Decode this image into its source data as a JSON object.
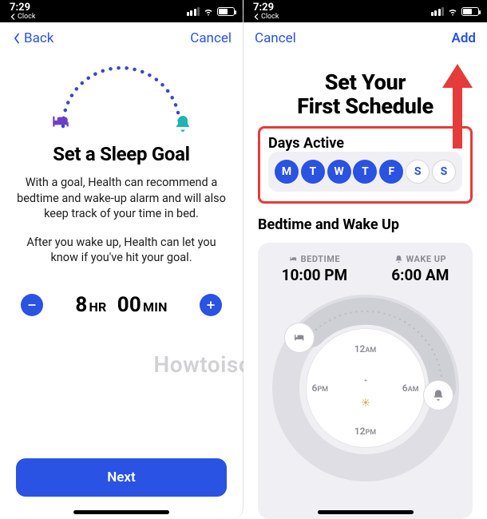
{
  "status": {
    "time": "7:29",
    "breadcrumb": "Clock"
  },
  "screen1": {
    "nav": {
      "back": "Back",
      "cancel": "Cancel"
    },
    "title": "Set a Sleep Goal",
    "paragraph1": "With a goal, Health can recommend a bedtime and wake-up alarm and will also keep track of your time in bed.",
    "paragraph2": "After you wake up, Health can let you know if you've hit your goal.",
    "goal": {
      "hours": "8",
      "hours_unit": "HR",
      "minutes": "00",
      "minutes_unit": "MIN"
    },
    "next_label": "Next",
    "colors": {
      "bed": "#6d3fc7",
      "bell": "#1fb5b0",
      "accent": "#2a52e3"
    }
  },
  "screen2": {
    "nav": {
      "cancel": "Cancel",
      "add": "Add"
    },
    "title_line1": "Set Your",
    "title_line2": "First Schedule",
    "days_active_label": "Days Active",
    "days": [
      {
        "letter": "M",
        "active": true
      },
      {
        "letter": "T",
        "active": true
      },
      {
        "letter": "W",
        "active": true
      },
      {
        "letter": "T",
        "active": true
      },
      {
        "letter": "F",
        "active": true
      },
      {
        "letter": "S",
        "active": false
      },
      {
        "letter": "S",
        "active": false
      }
    ],
    "bedtime_wakeup_label": "Bedtime and Wake Up",
    "bedtime": {
      "label": "BEDTIME",
      "value": "10:00 PM"
    },
    "wakeup": {
      "label": "WAKE UP",
      "value": "6:00 AM"
    },
    "dial_labels": {
      "top": "12",
      "top_suffix": "AM",
      "right": "6",
      "right_suffix": "AM",
      "bottom": "12",
      "bottom_suffix": "PM",
      "left": "6",
      "left_suffix": "PM"
    }
  },
  "watermark": "Howtoisolve.com",
  "annotation": {
    "arrow_color": "#e63b3b",
    "box_color": "#e63b3b"
  }
}
